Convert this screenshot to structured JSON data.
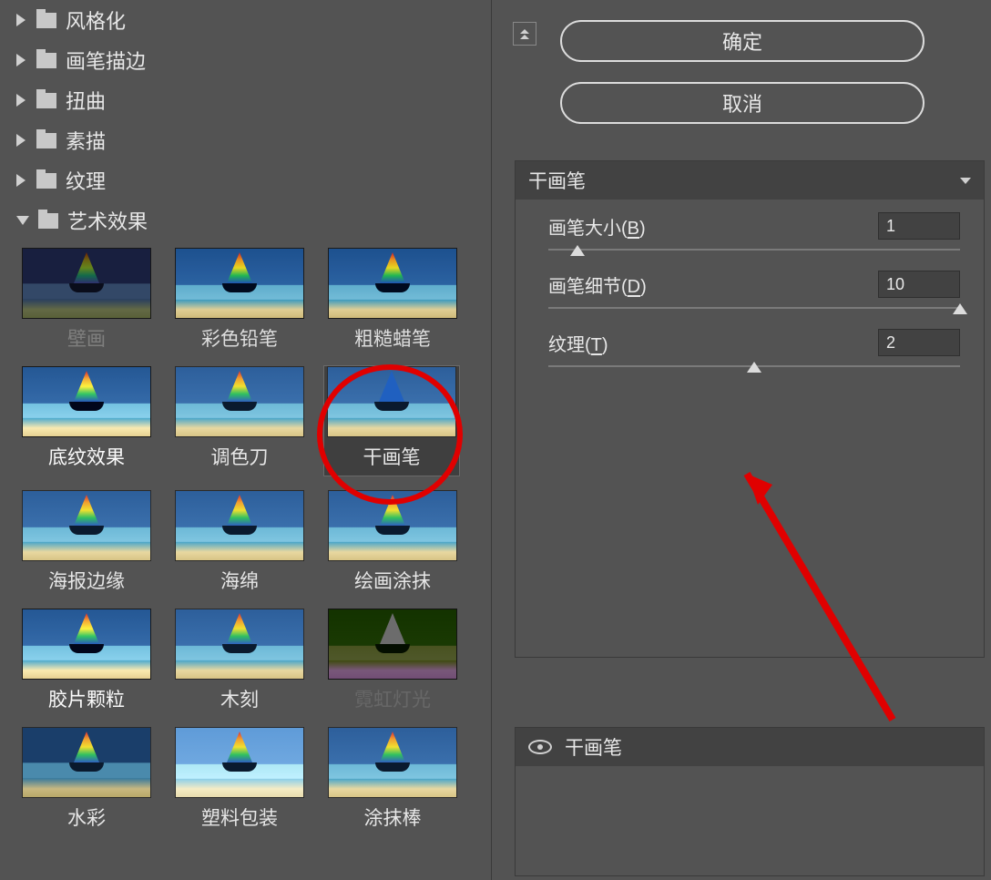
{
  "buttons": {
    "ok": "确定",
    "cancel": "取消"
  },
  "categories": [
    {
      "label": "风格化",
      "open": false
    },
    {
      "label": "画笔描边",
      "open": false
    },
    {
      "label": "扭曲",
      "open": false
    },
    {
      "label": "素描",
      "open": false
    },
    {
      "label": "纹理",
      "open": false
    },
    {
      "label": "艺术效果",
      "open": true
    }
  ],
  "filters": [
    {
      "label": "壁画"
    },
    {
      "label": "彩色铅笔"
    },
    {
      "label": "粗糙蜡笔"
    },
    {
      "label": "底纹效果"
    },
    {
      "label": "调色刀"
    },
    {
      "label": "干画笔",
      "selected": true
    },
    {
      "label": "海报边缘"
    },
    {
      "label": "海绵"
    },
    {
      "label": "绘画涂抹"
    },
    {
      "label": "胶片颗粒"
    },
    {
      "label": "木刻"
    },
    {
      "label": "霓虹灯光"
    },
    {
      "label": "水彩"
    },
    {
      "label": "塑料包装"
    },
    {
      "label": "涂抹棒"
    }
  ],
  "current_filter_name": "干画笔",
  "sliders": {
    "brush_size": {
      "label": "画笔大小",
      "hotkey": "B",
      "value": "1",
      "pos_pct": 7
    },
    "brush_detail": {
      "label": "画笔细节",
      "hotkey": "D",
      "value": "10",
      "pos_pct": 100
    },
    "texture": {
      "label": "纹理",
      "hotkey": "T",
      "value": "2",
      "pos_pct": 50
    }
  },
  "applied_list": [
    {
      "name": "干画笔",
      "visible": true
    }
  ]
}
